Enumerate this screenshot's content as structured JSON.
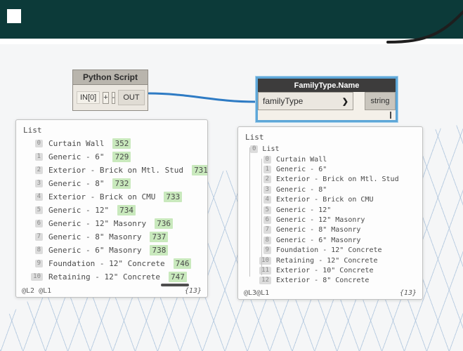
{
  "colors": {
    "topbar": "#0c3a39",
    "selection_blue": "#5ea7d8",
    "wire_blue": "#2e7bc4",
    "wire_black": "#1e1e1e",
    "value_green": "#c9e9bd"
  },
  "nodes": {
    "python": {
      "title": "Python Script",
      "input_port": "IN[0]",
      "add_button": "+",
      "remove_button": "-",
      "output_port": "OUT"
    },
    "family_type": {
      "title": "FamilyType.Name",
      "input_port": "familyType",
      "chevron": "❯",
      "output_port": "string"
    }
  },
  "left_preview": {
    "title": "List",
    "items": [
      {
        "index": "0",
        "label": "Curtain Wall",
        "value": "352"
      },
      {
        "index": "1",
        "label": "Generic - 6\"",
        "value": "729"
      },
      {
        "index": "2",
        "label": "Exterior - Brick on Mtl. Stud",
        "value": "731"
      },
      {
        "index": "3",
        "label": "Generic - 8\"",
        "value": "732"
      },
      {
        "index": "4",
        "label": "Exterior - Brick on CMU",
        "value": "733"
      },
      {
        "index": "5",
        "label": "Generic - 12\"",
        "value": "734"
      },
      {
        "index": "6",
        "label": "Generic - 12\" Masonry",
        "value": "736"
      },
      {
        "index": "7",
        "label": "Generic - 8\" Masonry",
        "value": "737"
      },
      {
        "index": "8",
        "label": "Generic - 6\" Masonry",
        "value": "738"
      },
      {
        "index": "9",
        "label": "Foundation - 12\" Concrete",
        "value": "746"
      },
      {
        "index": "10",
        "label": "Retaining - 12\" Concrete",
        "value": "747"
      }
    ],
    "footer_left": "@L2 @L1",
    "footer_right": "{13}"
  },
  "right_preview": {
    "title": "List",
    "sublist_index": "0",
    "sublist_label": "List",
    "items": [
      {
        "index": "0",
        "label": "Curtain Wall"
      },
      {
        "index": "1",
        "label": "Generic - 6\""
      },
      {
        "index": "2",
        "label": "Exterior - Brick on Mtl. Stud"
      },
      {
        "index": "3",
        "label": "Generic - 8\""
      },
      {
        "index": "4",
        "label": "Exterior - Brick on CMU"
      },
      {
        "index": "5",
        "label": "Generic - 12\""
      },
      {
        "index": "6",
        "label": "Generic - 12\" Masonry"
      },
      {
        "index": "7",
        "label": "Generic - 8\" Masonry"
      },
      {
        "index": "8",
        "label": "Generic - 6\" Masonry"
      },
      {
        "index": "9",
        "label": "Foundation - 12\" Concrete"
      },
      {
        "index": "10",
        "label": "Retaining - 12\" Concrete"
      },
      {
        "index": "11",
        "label": "Exterior - 10\" Concrete"
      },
      {
        "index": "12",
        "label": "Exterior - 8\" Concrete"
      }
    ],
    "footer_left": "@L3@L1",
    "footer_right": "{13}"
  }
}
